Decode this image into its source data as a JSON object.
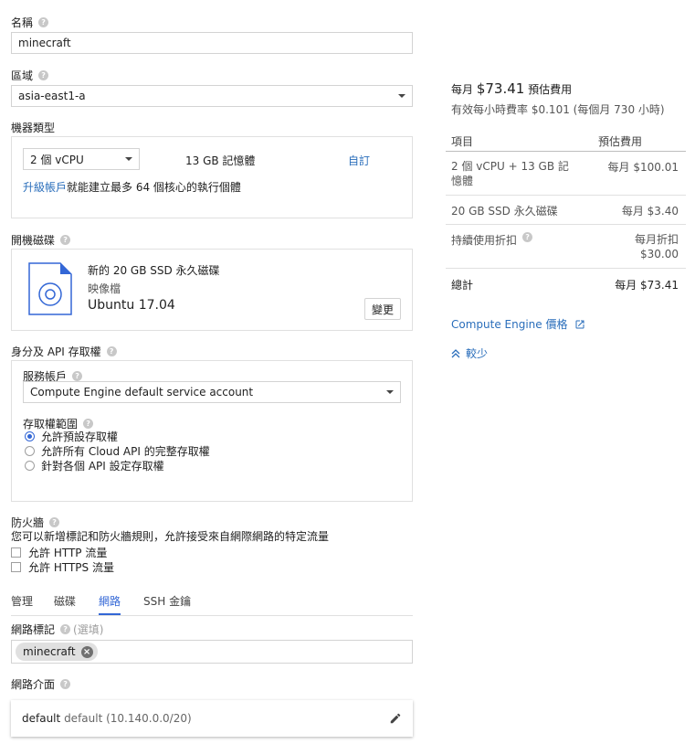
{
  "name_section": {
    "label": "名稱",
    "value": "minecraft"
  },
  "zone_section": {
    "label": "區域",
    "value": "asia-east1-a"
  },
  "machine_type": {
    "label": "機器類型",
    "cpu_value": "2 個 vCPU",
    "memory": "13 GB 記憶體",
    "custom_link": "自訂",
    "upgrade_link": "升級帳戶",
    "upgrade_text": "就能建立最多 64 個核心的執行個體"
  },
  "boot_disk": {
    "label": "開機磁碟",
    "title": "新的 20 GB SSD 永久磁碟",
    "image_label": "映像檔",
    "image_name": "Ubuntu 17.04",
    "change_button": "變更"
  },
  "identity": {
    "label": "身分及 API 存取權",
    "service_account_label": "服務帳戶",
    "service_account_value": "Compute Engine default service account",
    "access_scope_label": "存取權範圍",
    "options": [
      "允許預設存取權",
      "允許所有 Cloud API 的完整存取權",
      "針對各個 API 設定存取權"
    ]
  },
  "firewall": {
    "label": "防火牆",
    "desc": "您可以新增標記和防火牆規則，允許接受來自網際網路的特定流量",
    "http": "允許 HTTP 流量",
    "https": "允許 HTTPS 流量"
  },
  "tabs": [
    "管理",
    "磁碟",
    "網路",
    "SSH 金鑰"
  ],
  "network": {
    "tags_label": "網路標記",
    "optional": "(選填)",
    "tag_chip": "minecraft",
    "interfaces_label": "網路介面",
    "interface_name": "default",
    "interface_detail": "default (10.140.0.0/20)"
  },
  "pricing": {
    "monthly_prefix": "每月",
    "monthly_amount": "$73.41",
    "estimate_label": "預估費用",
    "hourly_prefix": "有效每小時費率",
    "hourly_rate": "$0.101",
    "hourly_suffix": "(每個月 730 小時)",
    "header_item": "項目",
    "header_cost": "預估費用",
    "rows": [
      {
        "item": "2 個 vCPU + 13 GB 記憶體",
        "cost": "每月 $100.01"
      },
      {
        "item": "20 GB SSD 永久磁碟",
        "cost": "每月 $3.40"
      },
      {
        "item": "持續使用折扣",
        "cost": "每月折扣 $30.00"
      }
    ],
    "total_label": "總計",
    "total_value": "每月 $73.41",
    "pricing_link": "Compute Engine 價格",
    "less_link": "較少"
  },
  "colors": {
    "accent": "#3367d6",
    "link": "#2a6ebb",
    "border": "#e0e0e0"
  }
}
